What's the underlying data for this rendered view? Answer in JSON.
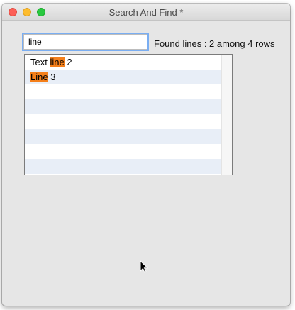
{
  "window": {
    "title": "Search And Find *"
  },
  "search": {
    "value": "line"
  },
  "status": {
    "found_text": "Found lines : 2 among 4 rows"
  },
  "results": [
    {
      "before": "Text ",
      "match": "line",
      "after": " 2"
    },
    {
      "before": "",
      "match": "Line",
      "after": " 3"
    }
  ],
  "colors": {
    "highlight": "#f47f1a",
    "row_alt": "#e8eef7",
    "focus_ring": "#7aaef2"
  }
}
